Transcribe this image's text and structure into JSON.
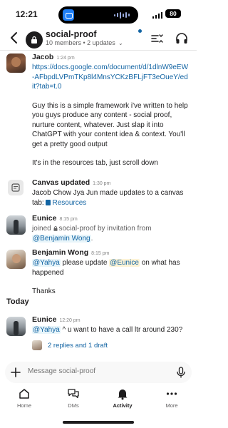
{
  "status_bar": {
    "time": "12:21",
    "battery": "80"
  },
  "header": {
    "channel_name": "social-proof",
    "meta": "10 members • 2 updates",
    "back_label": "Back"
  },
  "messages": [
    {
      "author": "Jacob",
      "time": "1:24 pm",
      "link": "https://docs.google.com/document/d/1dlnW9eEW-AFbpdLVPmTKp8l4MnsYCKzBFLjFT3eOueY/edit?tab=t.0",
      "para1": "Guy this is a simple framework i've written to help you guys produce any content - social proof, nurture content, whatever. Just slap it into ChatGPT with your content idea & context. You'll get a pretty good output",
      "para2": "It's in the resources tab, just scroll down"
    },
    {
      "author": "Canvas updated",
      "time": "1:30 pm",
      "text_prefix": "Jacob Chow Jya Jun made updates to a canvas tab:",
      "resource": "Resources"
    },
    {
      "author": "Eunice",
      "time": "8:15 pm",
      "text_prefix": "joined",
      "channel_ref": "social-proof",
      "text_mid": "by invitation from",
      "mention": "@Benjamin Wong",
      "text_suffix": "."
    },
    {
      "author": "Benjamin Wong",
      "time": "8:15 pm",
      "mention1": "@Yahya",
      "text_mid": "please update",
      "mention2": "@Eunice",
      "text_suffix": "on what has happened",
      "para2": "Thanks"
    }
  ],
  "day_divider": "Today",
  "today_message": {
    "author": "Eunice",
    "time": "12:20 pm",
    "mention": "@Yahya",
    "text": "^ u want to have a call ltr around 230?",
    "thread_text": "2 replies and 1 draft"
  },
  "composer": {
    "placeholder": "Message social-proof"
  },
  "tabs": [
    {
      "label": "Home"
    },
    {
      "label": "DMs"
    },
    {
      "label": "Activity"
    },
    {
      "label": "More"
    }
  ],
  "colors": {
    "link": "#1264a3",
    "text": "#1d1c1d",
    "muted": "#616061"
  }
}
